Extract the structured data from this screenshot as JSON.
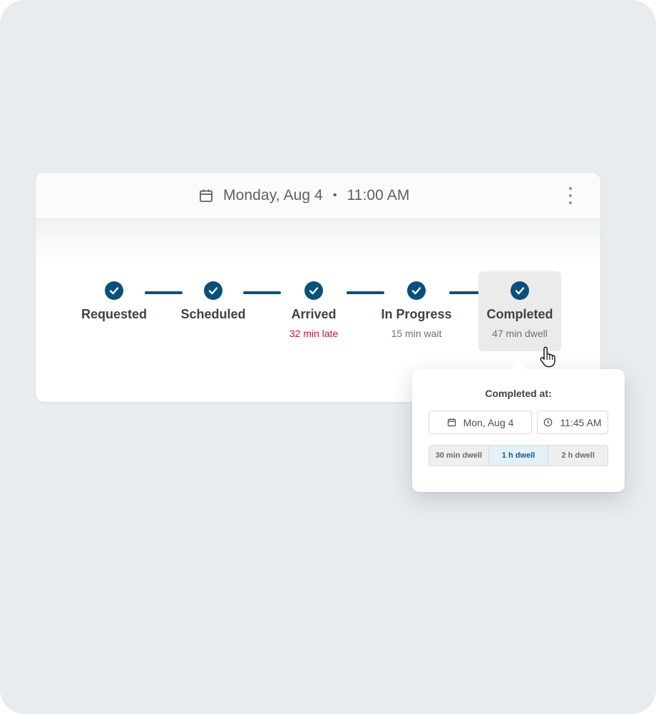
{
  "header": {
    "date": "Monday, Aug 4",
    "separator": "•",
    "time": "11:00 AM"
  },
  "icons": {
    "calendar": "calendar-icon",
    "more": "more-vertical-icon",
    "check": "check-icon",
    "clock": "clock-icon",
    "cursor": "pointer-hand-icon"
  },
  "steps": [
    {
      "label": "Requested",
      "sub": "",
      "status": "done"
    },
    {
      "label": "Scheduled",
      "sub": "",
      "status": "done"
    },
    {
      "label": "Arrived",
      "sub": "32 min late",
      "status": "done"
    },
    {
      "label": "In Progress",
      "sub": "15 min wait",
      "status": "done"
    },
    {
      "label": "Completed",
      "sub": "47 min dwell",
      "status": "done",
      "active": true
    }
  ],
  "popover": {
    "title": "Completed at:",
    "date_value": "Mon, Aug 4",
    "time_value": "11:45 AM",
    "dwell_options": [
      "30 min dwell",
      "1 h dwell",
      "2 h dwell"
    ],
    "selected_option": "1 h dwell"
  },
  "colors": {
    "background": "#e8ecef",
    "primary": "#0b4f7c",
    "late": "#c8104a",
    "selected_segment": "#e4f0f8"
  }
}
